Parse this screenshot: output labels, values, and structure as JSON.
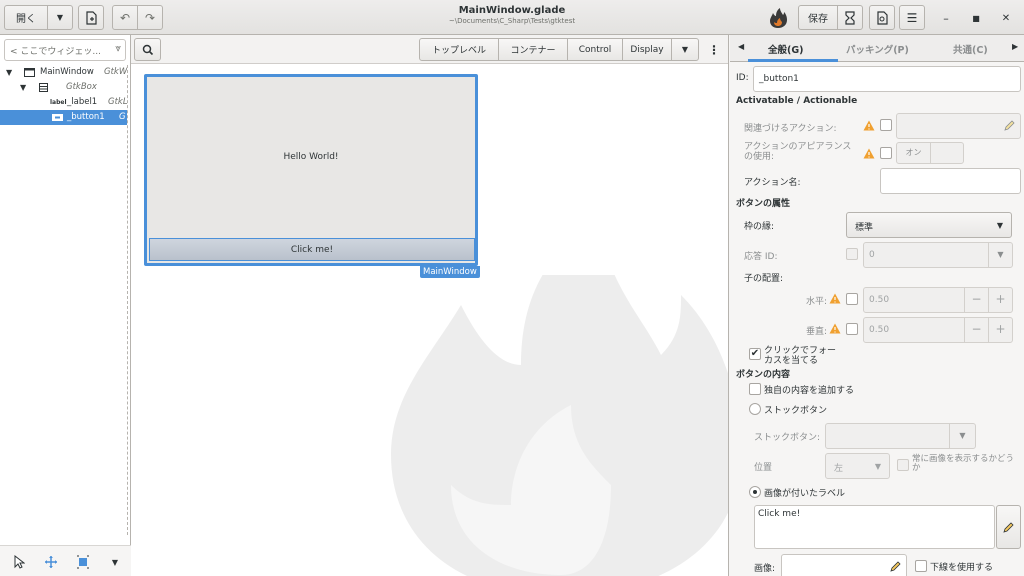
{
  "header": {
    "open_label": "開く",
    "title": "MainWindow.glade",
    "subtitle": "~\\Documents\\C_Sharp\\Tests\\gtktest",
    "save_label": "保存"
  },
  "left": {
    "search_placeholder": "< ここでウィジェッ...",
    "tree": [
      {
        "name": "MainWindow",
        "type": "GtkW"
      },
      {
        "name": "",
        "type": "GtkBox"
      },
      {
        "name": "_label1",
        "type": "GtkL",
        "icon_text": "label"
      },
      {
        "name": "_button1",
        "type": "G"
      }
    ]
  },
  "center": {
    "toolbar": [
      "トップレベル",
      "コンテナー",
      "Control",
      "Display"
    ],
    "preview": {
      "label": "Hello World!",
      "button": "Click me!",
      "tag": "MainWindow"
    }
  },
  "right": {
    "tabs": [
      "全般(G)",
      "パッキング(P)",
      "共通(C)"
    ],
    "id_label": "ID:",
    "id_value": "_button1",
    "sec_actionable": "Activatable / Actionable",
    "related_action": "関連づけるアクション:",
    "use_action_appearance": "アクションのアピアランスの使用:",
    "toggle_on": "オン",
    "action_name": "アクション名:",
    "sec_button_props": "ボタンの属性",
    "relief_label": "枠の縁:",
    "relief_value": "標準",
    "response_id_label": "応答 ID:",
    "response_id_value": "0",
    "child_placement": "子の配置:",
    "halign_label": "水平:",
    "halign_value": "0.50",
    "valign_label": "垂直:",
    "valign_value": "0.50",
    "focus_on_click": "クリックでフォーカスを当てる",
    "sec_button_content": "ボタンの内容",
    "custom_content": "独自の内容を追加する",
    "stock_button_radio": "ストックボタン",
    "stock_button_label": "ストックボタン:",
    "position_label": "位置",
    "position_value": "左",
    "always_show_image": "常に画像を表示するかどうか",
    "label_with_image": "画像が付いたラベル",
    "label_text": "Click me!",
    "image_label": "画像:",
    "use_underline": "下線を使用する"
  }
}
